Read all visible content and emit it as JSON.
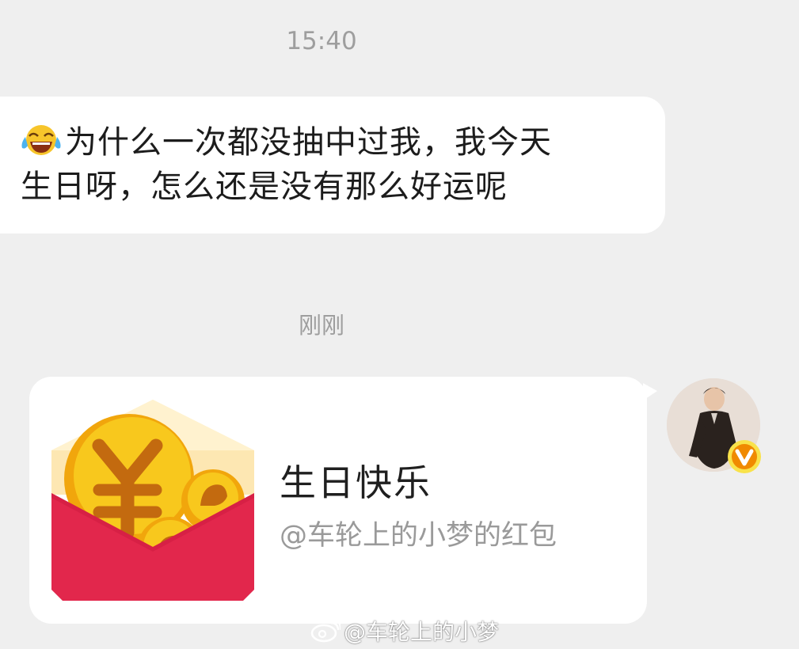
{
  "chat": {
    "timestamp_first": "15:40",
    "timestamp_second": "刚刚",
    "incoming_message": {
      "emoji": "tears-of-joy-emoji",
      "line1": "为什么一次都没抽中过我，我今天",
      "line2": "生日呀，怎么还是没有那么好运呢"
    },
    "red_packet_card": {
      "title": "生日快乐",
      "subtitle": "@车轮上的小梦的红包",
      "icon": "red-envelope-icon"
    },
    "sender_avatar": {
      "badge": "verified-v-badge"
    }
  },
  "watermark": {
    "text": "@车轮上的小梦",
    "icon": "weibo-logo-icon"
  },
  "colors": {
    "background": "#efefef",
    "bubble": "#ffffff",
    "envelope_red": "#e2274c",
    "coin_gold": "#f4b712",
    "badge_orange": "#f08a00"
  }
}
